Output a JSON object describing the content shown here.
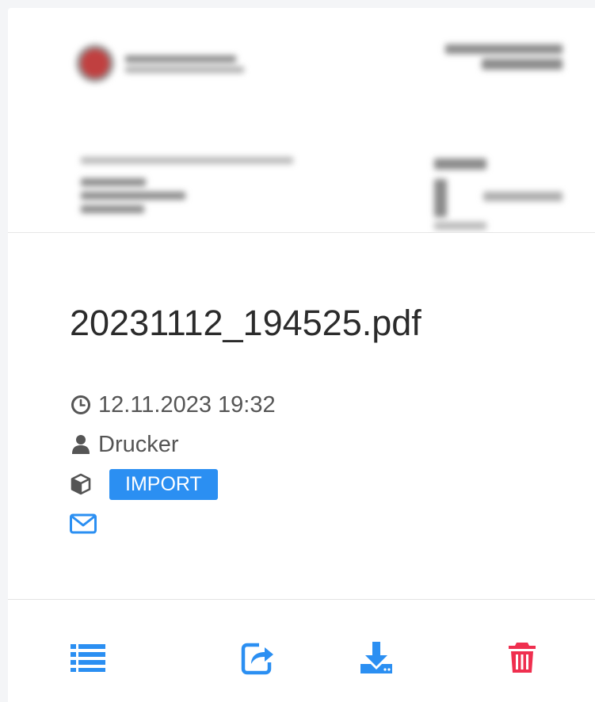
{
  "file": {
    "name": "20231112_194525.pdf",
    "date": "12.11.2023 19:32",
    "user": "Drucker",
    "tag": "IMPORT"
  },
  "icons": {
    "date": "clock-icon",
    "user": "user-icon",
    "tag": "cube-icon",
    "mail": "envelope-icon",
    "list": "list-icon",
    "share": "share-icon",
    "download": "download-icon",
    "delete": "trash-icon"
  },
  "colors": {
    "accent": "#2b8ff2",
    "danger": "#ef2f4f",
    "text": "#2b2b2b",
    "muted": "#555555"
  }
}
